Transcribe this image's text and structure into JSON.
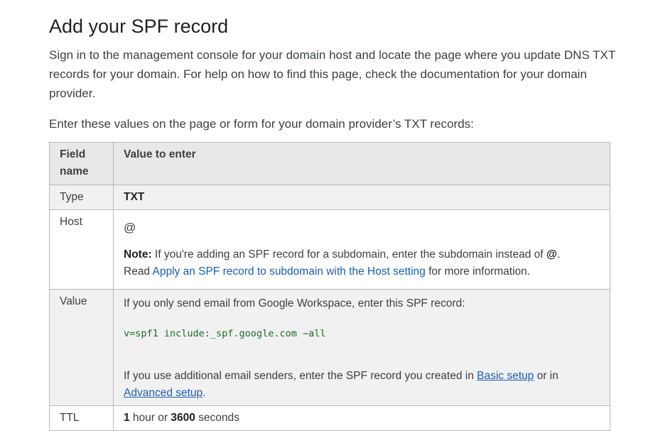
{
  "heading": "Add your SPF record",
  "intro": "Sign in to the management console for your domain host and locate the page where you update DNS TXT records for your domain. For help on how to find this page, check the documentation for your domain provider.",
  "lead": "Enter these values on the page or form for your domain provider’s TXT records:",
  "table": {
    "header_field": "Field name",
    "header_value": "Value to enter",
    "type": {
      "field": "Type",
      "value": "TXT"
    },
    "host": {
      "field": "Host",
      "value": "@",
      "note_label": "Note:",
      "note_text": " If you're adding an SPF record for a subdomain, enter the subdomain instead of ",
      "note_at": "@",
      "note_end": ".",
      "read_prefix": "Read ",
      "read_link": "Apply an SPF record to subdomain with the Host setting",
      "read_suffix": " for more information."
    },
    "value": {
      "field": "Value",
      "line1": "If you only send email from Google Workspace, enter this SPF record:",
      "spf_record": "v=spf1 include:_spf.google.com ~all",
      "line2_prefix": "If you use additional email senders, enter the SPF record you created in ",
      "basic_link": "Basic setup",
      "line2_mid": " or in ",
      "advanced_link": "Advanced setup",
      "line2_end": "."
    },
    "ttl": {
      "field": "TTL",
      "num1": "1",
      "mid": " hour or ",
      "num2": "3600",
      "end": " seconds"
    }
  },
  "colors": {
    "link": "#1a5fb4",
    "code": "#1e6b2a",
    "header_bg": "#e8e8e8",
    "shaded_bg": "#f1f1f1",
    "border": "#b7b7b7"
  }
}
